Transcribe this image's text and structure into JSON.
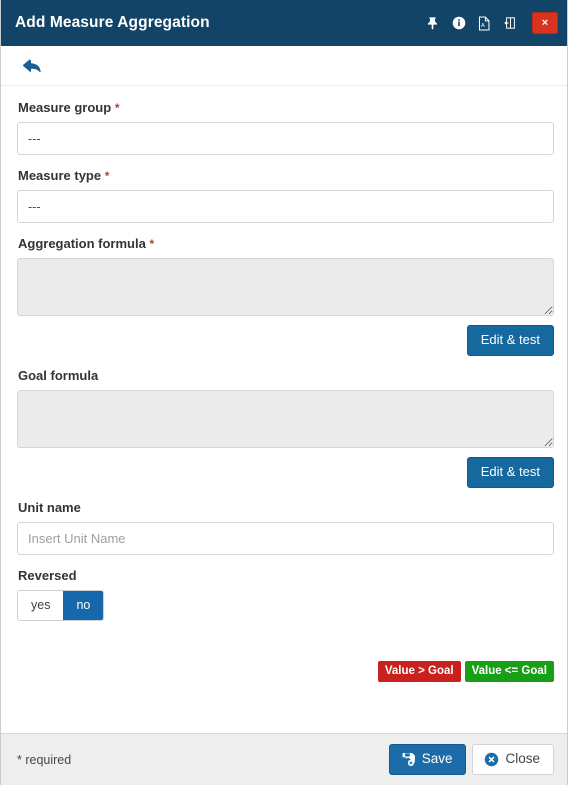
{
  "titlebar": {
    "title": "Add Measure Aggregation",
    "icons": [
      {
        "name": "pin-icon",
        "label": "Pin"
      },
      {
        "name": "info-icon",
        "label": "Info"
      },
      {
        "name": "pdf-icon",
        "label": "Export PDF"
      },
      {
        "name": "expand-icon",
        "label": "Expand"
      }
    ],
    "close_label": "×",
    "close_color": "#d9331f",
    "background_color": "#114466"
  },
  "toolbar": {
    "back_icon": "back-arrow-icon",
    "back_color": "#1b5e93"
  },
  "form": {
    "measure_group": {
      "label": "Measure group",
      "required_mark": "*",
      "value": "---"
    },
    "measure_type": {
      "label": "Measure type",
      "required_mark": "*",
      "value": "---"
    },
    "aggregation_formula": {
      "label": "Aggregation formula",
      "required_mark": "*",
      "value": "",
      "edit_button": "Edit & test"
    },
    "goal_formula": {
      "label": "Goal formula",
      "required_mark": "",
      "value": "",
      "edit_button": "Edit & test"
    },
    "unit_name": {
      "label": "Unit name",
      "value": "",
      "placeholder": "Insert Unit Name"
    },
    "reversed": {
      "label": "Reversed",
      "yes_label": "yes",
      "no_label": "no",
      "selected": "no"
    }
  },
  "legend": {
    "red_badge": "Value > Goal",
    "green_badge": "Value <= Goal",
    "red_color": "#c9211e",
    "green_color": "#17a017"
  },
  "footer": {
    "required_note": "* required",
    "save_label": "Save",
    "close_label": "Close",
    "save_color": "#1b6ca8"
  }
}
